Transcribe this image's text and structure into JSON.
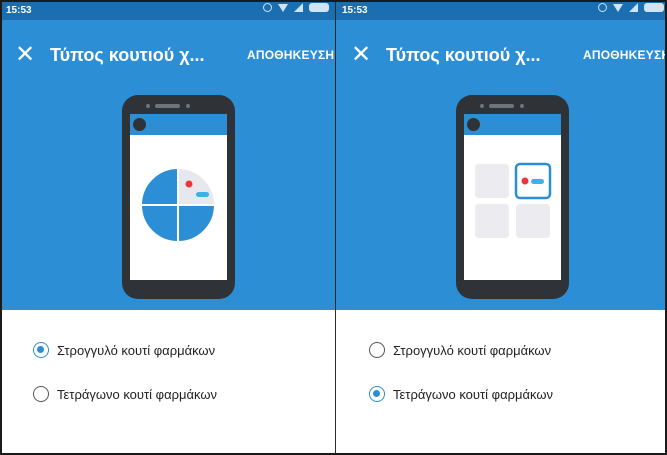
{
  "panels": [
    {
      "status_time": "15:53",
      "title": "Τύπος κουτιού χ...",
      "save_label": "ΑΠΟΘΗΚΕΥΣΗ",
      "options": [
        {
          "label": "Στρογγυλό κουτί φαρμάκων",
          "selected": true
        },
        {
          "label": "Τετράγωνο κουτί φαρμάκων",
          "selected": false
        }
      ]
    },
    {
      "status_time": "15:53",
      "title": "Τύπος κουτιού χ...",
      "save_label": "ΑΠΟΘΗΚΕΥΣΗ",
      "options": [
        {
          "label": "Στρογγυλό κουτί φαρμάκων",
          "selected": false
        },
        {
          "label": "Τετράγωνο κουτί φαρμάκων",
          "selected": true
        }
      ]
    }
  ],
  "colors": {
    "primary": "#2c8fd6",
    "statusbar": "#1b6fb0",
    "phone_body": "#2f3237",
    "pill_red": "#e8383d",
    "pill_blue": "#3fb0e8",
    "slot_gray": "#ebebf0"
  },
  "icons": [
    "close-icon",
    "alarm-icon",
    "wifi-icon",
    "signal-icon",
    "battery-icon"
  ]
}
